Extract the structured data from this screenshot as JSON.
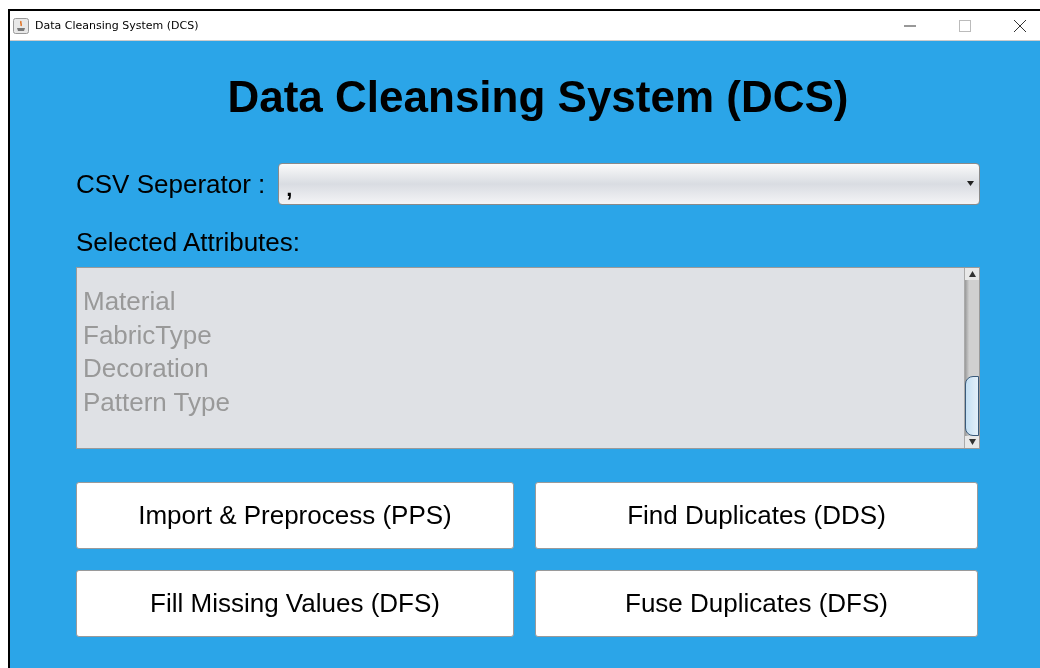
{
  "window": {
    "title": "Data Cleansing System (DCS)"
  },
  "heading": "Data Cleansing System (DCS)",
  "separator": {
    "label": "CSV Seperator :",
    "value": ","
  },
  "attributes": {
    "label": "Selected Attributes:",
    "disabled": true,
    "items": [
      "Material",
      "FabricType",
      "Decoration",
      "Pattern Type"
    ]
  },
  "buttons": [
    "Import & Preprocess (PPS)",
    "Find Duplicates (DDS)",
    "Fill Missing Values (DFS)",
    "Fuse Duplicates (DFS)"
  ]
}
